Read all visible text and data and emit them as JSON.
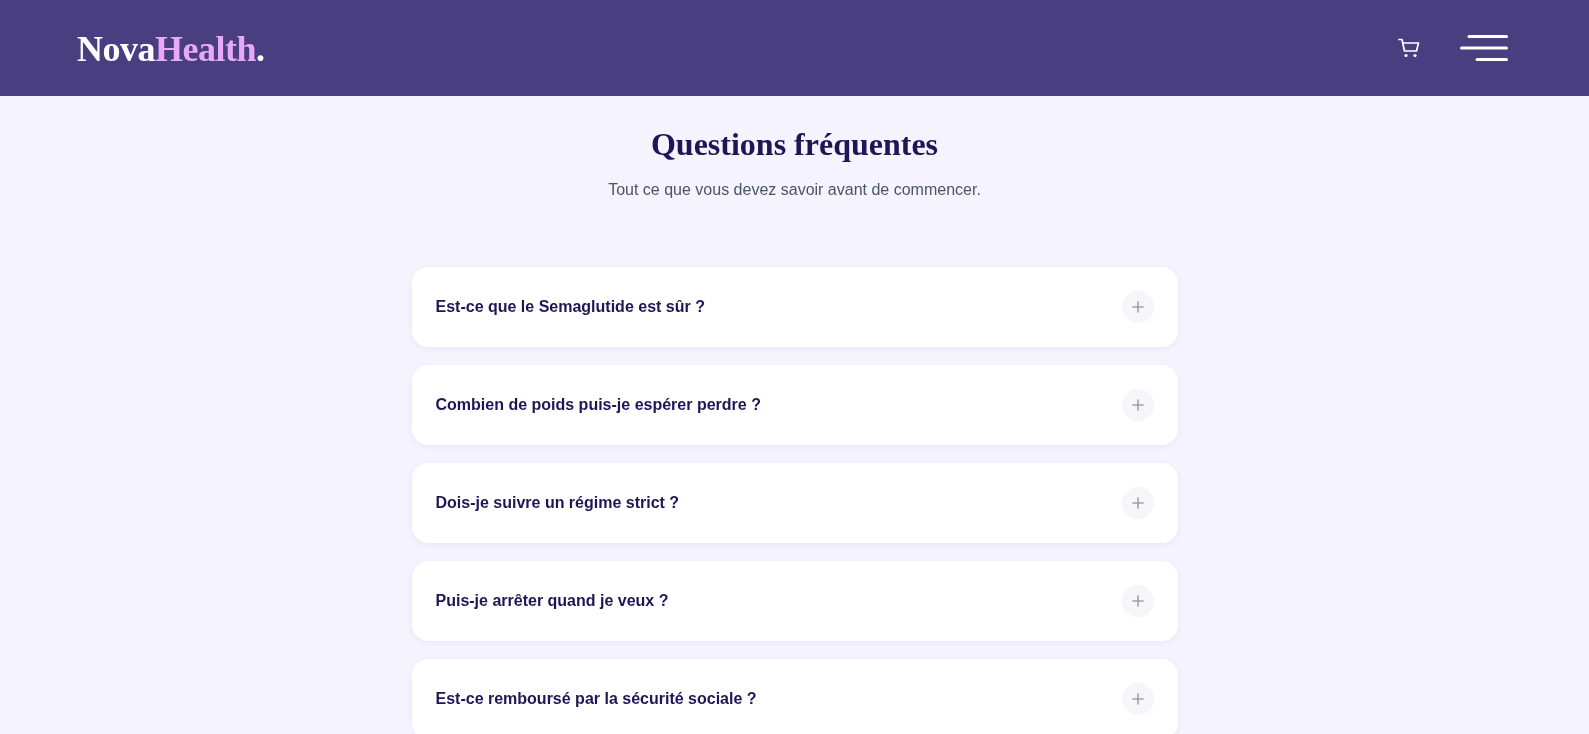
{
  "header": {
    "logo": {
      "primary": "Nova",
      "accent": "Health",
      "suffix": "."
    }
  },
  "faq": {
    "title": "Questions fréquentes",
    "subtitle": "Tout ce que vous devez savoir avant de commencer.",
    "items": [
      {
        "question": "Est-ce que le Semaglutide est sûr ?",
        "expanded": false
      },
      {
        "question": "Combien de poids puis-je espérer perdre ?",
        "expanded": false
      },
      {
        "question": "Dois-je suivre un régime strict ?",
        "expanded": false
      },
      {
        "question": "Puis-je arrêter quand je veux ?",
        "expanded": false
      },
      {
        "question": "Est-ce remboursé par la sécurité sociale ?",
        "expanded": false
      }
    ]
  }
}
